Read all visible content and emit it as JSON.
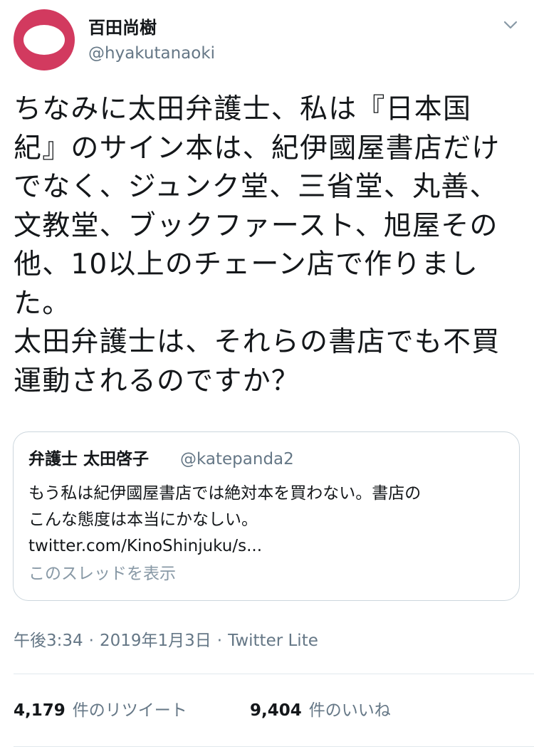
{
  "user": {
    "name": "百田尚樹",
    "handle": "@hyakutanaoki",
    "avatar_color": "#d23a5f"
  },
  "menu": {
    "icon": "chevron-down-icon"
  },
  "tweet": {
    "lines": [
      "ちなみに太田弁護士、私は『日本国",
      "紀』のサイン本は、紀伊國屋書店だけ",
      "でなく、ジュンク堂、三省堂、丸善、",
      "文教堂、ブックファースト、旭屋その",
      "他、10以上のチェーン店で作りまし",
      "た。",
      "太田弁護士は、それらの書店でも不買",
      "運動されるのですか？"
    ]
  },
  "quote": {
    "author": "弁護士 太田啓子",
    "handle": "@katepanda2",
    "lines": [
      "もう私は紀伊國屋書店では絶対本を買わない。書店の",
      "こんな態度は本当にかなしい。",
      "twitter.com/KinoShinjuku/s..."
    ],
    "thread_link": "このスレッドを表示"
  },
  "meta": {
    "time": "午後3:34",
    "separator": "·",
    "date": "2019年1月3日",
    "source": "Twitter Lite"
  },
  "stats": {
    "retweets_count": "4,179",
    "retweets_label": "件のリツイート",
    "likes_count": "9,404",
    "likes_label": "件のいいね"
  },
  "colors": {
    "text": "#14171a",
    "secondary": "#657786",
    "border": "#ccd6dd"
  }
}
